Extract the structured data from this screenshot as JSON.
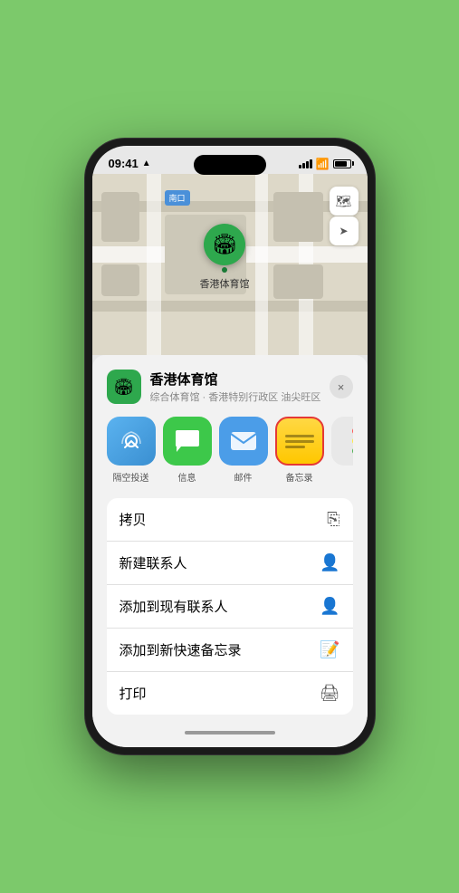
{
  "status": {
    "time": "09:41",
    "location_arrow": "▲"
  },
  "map": {
    "label": "南口",
    "venue_name": "香港体育馆",
    "controls": {
      "map_type": "🗺",
      "location": "➤"
    }
  },
  "venue_card": {
    "title": "香港体育馆",
    "subtitle": "综合体育馆 · 香港特别行政区 油尖旺区",
    "close_label": "×"
  },
  "share_items": [
    {
      "id": "airdrop",
      "label": "隔空投送",
      "type": "airdrop"
    },
    {
      "id": "messages",
      "label": "信息",
      "type": "messages"
    },
    {
      "id": "mail",
      "label": "邮件",
      "type": "mail"
    },
    {
      "id": "notes",
      "label": "备忘录",
      "type": "notes"
    }
  ],
  "actions": [
    {
      "label": "拷贝",
      "icon": "📋"
    },
    {
      "label": "新建联系人",
      "icon": "👤"
    },
    {
      "label": "添加到现有联系人",
      "icon": "👤"
    },
    {
      "label": "添加到新快速备忘录",
      "icon": "📝"
    },
    {
      "label": "打印",
      "icon": "🖨"
    }
  ],
  "colors": {
    "notes_border": "#e53935",
    "dot1": "#ff5252",
    "dot2": "#ffeb3b",
    "dot3": "#4caf50"
  }
}
